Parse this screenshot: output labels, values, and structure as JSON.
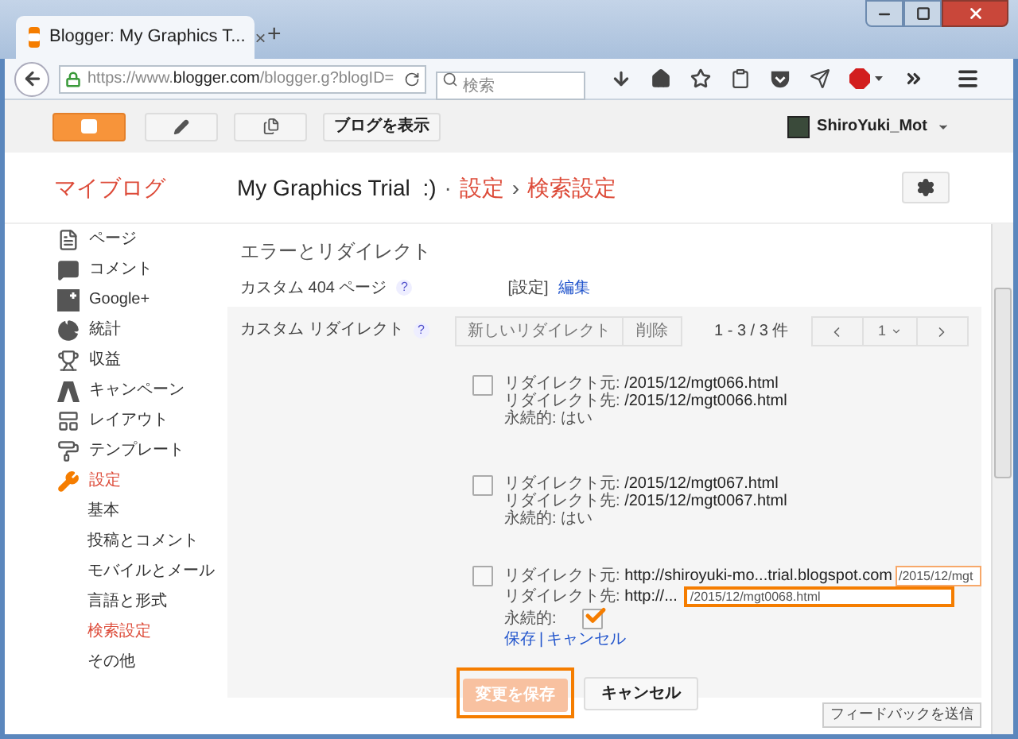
{
  "browser": {
    "tab_title": "Blogger: My Graphics T...",
    "tab_close": "×",
    "new_tab": "+",
    "url_prefix": "https://www.",
    "url_host": "blogger.com",
    "url_path": "/blogger.g?blogID=",
    "search_placeholder": "検索"
  },
  "blogger_bar": {
    "view_blog": "ブログを表示",
    "user": "ShiroYuki_Mot"
  },
  "header": {
    "my_blogs": "マイブログ",
    "blog_title": "My Graphics Trial  :)",
    "separator": "·",
    "crumb_1": "設定",
    "arrow": "›",
    "crumb_2": "検索設定"
  },
  "sidebar": {
    "items": [
      {
        "kind": "page",
        "label": "ページ",
        "selected": false
      },
      {
        "kind": "comment",
        "label": "コメント",
        "selected": false
      },
      {
        "kind": "gplus",
        "label": "Google+",
        "selected": false
      },
      {
        "kind": "stats",
        "label": "統計",
        "selected": false
      },
      {
        "kind": "earnings",
        "label": "収益",
        "selected": false
      },
      {
        "kind": "campaign",
        "label": "キャンペーン",
        "selected": false
      },
      {
        "kind": "layout",
        "label": "レイアウト",
        "selected": false
      },
      {
        "kind": "template",
        "label": "テンプレート",
        "selected": false
      },
      {
        "kind": "settings",
        "label": "設定",
        "selected": true,
        "children": [
          {
            "label": "基本",
            "selected": false
          },
          {
            "label": "投稿とコメント",
            "selected": false
          },
          {
            "label": "モバイルとメール",
            "selected": false
          },
          {
            "label": "言語と形式",
            "selected": false
          },
          {
            "label": "検索設定",
            "selected": true
          },
          {
            "label": "その他",
            "selected": false
          }
        ]
      }
    ]
  },
  "section": {
    "title": "エラーとリダイレクト",
    "custom_404": {
      "label": "カスタム 404 ページ",
      "help": "?",
      "value": "[設定]",
      "edit_link": "編集"
    },
    "custom_redirect": {
      "label": "カスタム リダイレクト",
      "help": "?",
      "new_button": "新しいリダイレクト",
      "delete_button": "削除",
      "count": "1 - 3 / 3 件",
      "page": "1",
      "items": [
        {
          "kind": "view",
          "checked": false,
          "from_label": "リダイレクト元: ",
          "from": "/2015/12/mgt066.html",
          "to_label": "リダイレクト先: ",
          "to": "/2015/12/mgt0066.html",
          "permanent_label": "永続的: ",
          "permanent": "はい"
        },
        {
          "kind": "view",
          "checked": false,
          "from_label": "リダイレクト元: ",
          "from": "/2015/12/mgt067.html",
          "to_label": "リダイレクト先: ",
          "to": "/2015/12/mgt0067.html",
          "permanent_label": "永続的: ",
          "permanent": "はい"
        },
        {
          "kind": "edit",
          "checked": false,
          "from_label": "リダイレクト元: ",
          "from_host": "http://shiroyuki-mo...trial.blogspot.com",
          "from_value": "/2015/12/mgt",
          "from_highlighted": true,
          "to_label": "リダイレクト先: ",
          "to_host": "http://...",
          "to_value": "/2015/12/mgt0068.html",
          "to_highlighted": true,
          "permanent_label": "永続的:",
          "permanent_checked": true,
          "save_link": "保存",
          "link_separator": "|",
          "cancel_link": "キャンセル"
        }
      ]
    }
  },
  "actions": {
    "save": "変更を保存",
    "save_disabled": true,
    "save_highlighted": true,
    "cancel": "キャンセル"
  },
  "feedback": "フィードバックを送信"
}
